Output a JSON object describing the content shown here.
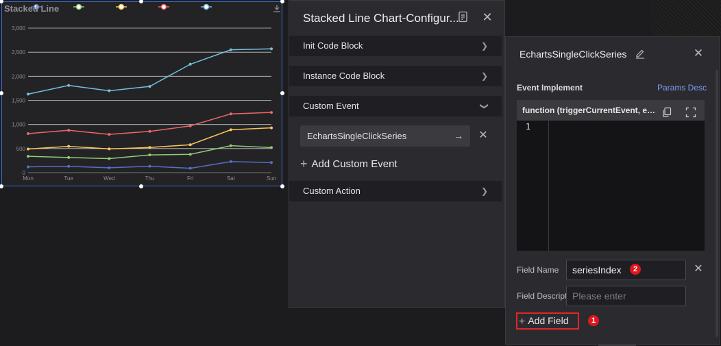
{
  "chart_widget": {
    "title": "Stacked Line",
    "icon_download": "download-icon"
  },
  "chart_data": {
    "type": "line",
    "categories": [
      "Mon",
      "Tue",
      "Wed",
      "Thu",
      "Fri",
      "Sat",
      "Sun"
    ],
    "ylim": [
      0,
      3000
    ],
    "yticks": [
      "0",
      "500",
      "1,000",
      "1,500",
      "2,000",
      "2,500",
      "3,000"
    ],
    "title": "Stacked Line",
    "legend_position": "top",
    "grid": true,
    "series": [
      {
        "color": "#5470c6",
        "values": [
          120,
          132,
          101,
          134,
          90,
          230,
          210
        ]
      },
      {
        "color": "#91cc75",
        "values": [
          340,
          314,
          292,
          368,
          380,
          560,
          520
        ]
      },
      {
        "color": "#fac858",
        "values": [
          490,
          546,
          493,
          522,
          580,
          890,
          930
        ]
      },
      {
        "color": "#ee6666",
        "values": [
          810,
          880,
          794,
          856,
          970,
          1220,
          1250
        ]
      },
      {
        "color": "#73c0de",
        "values": [
          1630,
          1810,
          1700,
          1790,
          2250,
          2550,
          2570
        ]
      }
    ]
  },
  "config_panel": {
    "title": "Stacked Line Chart-Configur...",
    "sections": {
      "init": "Init Code Block",
      "instance": "Instance Code Block",
      "custom_event": "Custom Event",
      "custom_action": "Custom Action"
    },
    "event_item": "EchartsSingleClickSeries",
    "add_custom_event": "Add Custom Event"
  },
  "series_panel": {
    "title": "EchartsSingleClickSeries",
    "event_implement": "Event Implement",
    "params_desc": "Params Desc",
    "function_signature": "function (triggerCurrentEvent, echa...",
    "line_number": "1",
    "field_name_label": "Field Name",
    "field_name_value": "seriesIndex",
    "field_desc_label": "Field Descripti",
    "field_desc_placeholder": "Please enter",
    "add_field": "Add Field",
    "badge_1": "1",
    "badge_2": "2"
  },
  "colors": {
    "accent": "#7f9bf5",
    "highlight_red": "#e0262a",
    "panel_bg": "#2b2b2f"
  }
}
